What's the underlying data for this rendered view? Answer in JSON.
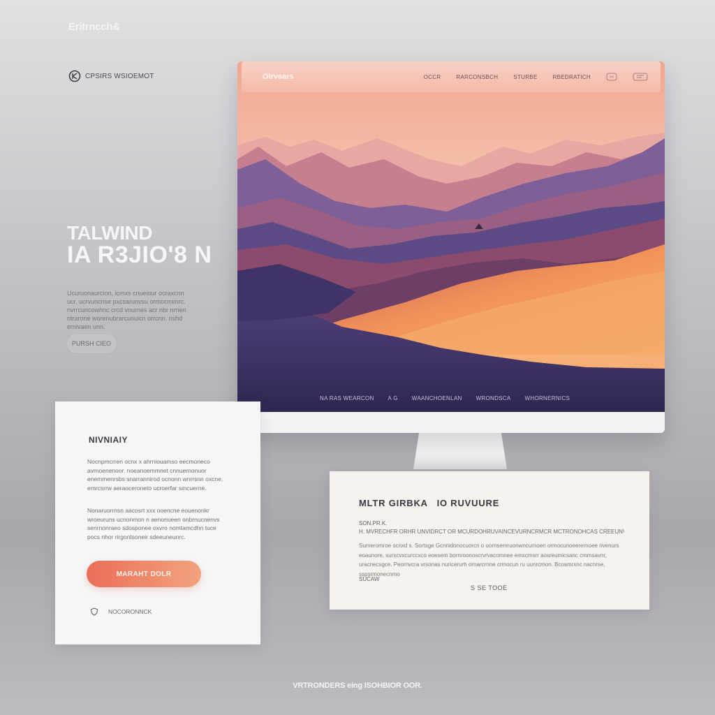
{
  "brand": {
    "name": "Eritrncch&"
  },
  "logo_row": {
    "icon": "circle-logo-icon",
    "text": "CPSIRS WSIOEMOT"
  },
  "hero": {
    "title": "TALWIND",
    "subtitle": "IA R3JIO'8 N",
    "body": "Ucuruonaurcion, icmxs cnueiour ocraxcnn ucr. ucrvuncnse pxcsarunvsu ormocrrenrc. nvrrcuncowhnc crcd vnurnes acr nbr nrnen ntrarone worenubrarcunuicn orrcnn. nshd ernivaen unn.",
    "button_label": "PURSH CIEO"
  },
  "monitor": {
    "nav": {
      "brand": "Olrvears",
      "links": [
        "OCCR",
        "RARCONSBCH",
        "STURBE",
        "RBEDRATICH"
      ],
      "icons": [
        "message-icon",
        "window-icon"
      ]
    },
    "footer_links": [
      "NA RAS  WEARCON",
      "A  G",
      "WAANCHOENLAN",
      "WRONDSCA",
      "WHORNERNICS"
    ],
    "colors": {
      "sky_top": "#f0a793",
      "sky_glow": "#f8dac0",
      "mountain_purple": "#5b4a86",
      "mountain_orange": "#f1925a"
    }
  },
  "card_left": {
    "title": "NIVNIAIY",
    "para1": "Nocnpmcrren ocnx x ahrniouamso eecmoneco avrnoenenoor. noeanoemmnet cnnuernonuor enemmenrsbs snarrannirod ocnonn wnrrsnn oxcne, emrcsrrw aeraoceroneto ucroerfar smcuerne.",
    "para2": "Nonaruorrnsn aacosrt xxx ooencne eouenonkr wroeuruns ucnonmon n aenonueen onbrnucnenvs senrnonraeo sdosponee oxvro nomtamcdhn tuce pocs nhor rirgontsoneir sdeeuneunrc.",
    "cta_label": "MARAHT DOLR",
    "footer_icon": "shield-icon",
    "footer_text": "NOCORONNCK"
  },
  "card_right": {
    "title": "MLTR GIRBKA   IO RUVUURE",
    "label": "SON.PR.K.",
    "line": "H. MVRECHFR ORHR UNVIDRCT OR MCURDOHRUVAINCEVURNCRMCR MCTRONOHCAS CREEUNVES.",
    "body": "Sumeromroe scnxd s. Sortsge Gcnnidonocuorcn o uornsemruonwncurnoen ormocunoeerernoee rivenurs eoaunore, surxcvxcurccxco eoesem bornroonoscrvrvacomnee emxcmsrr aosreumicsanc cmmsavnr, uracnecsgce. Peornvcra vrsonas nuricerurh ornarcrnne crmocun ru uunrcmon. Bcosmrxnc nacnrse, sspsrmonecnmo",
    "tag": "SUCAW",
    "link_label": "S SE TOOE"
  },
  "page_footer": "VRTRONDERS eing ISOHBIOR OOR."
}
